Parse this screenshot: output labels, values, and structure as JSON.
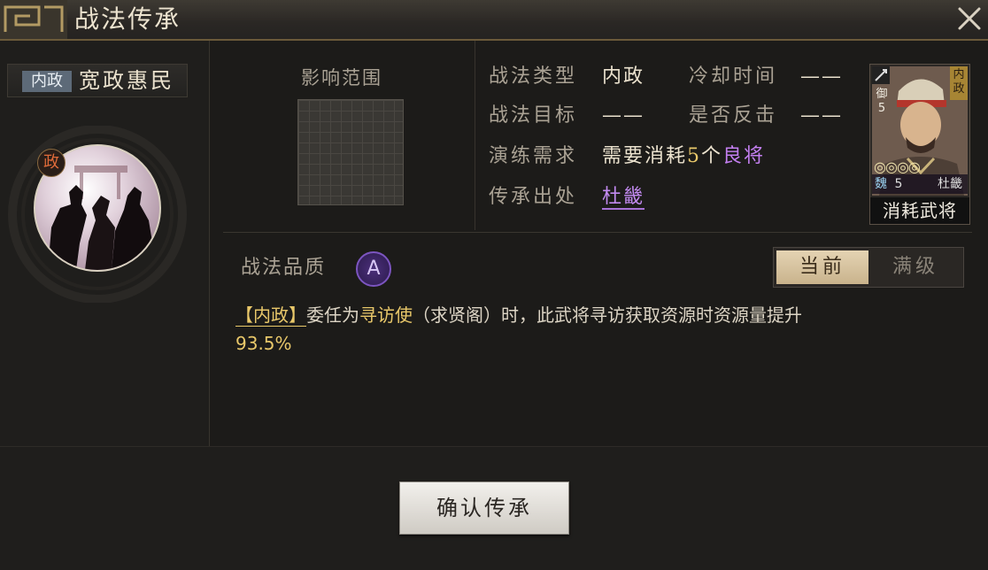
{
  "window": {
    "title": "战法传承",
    "close_icon": "close-icon"
  },
  "skill": {
    "type_badge": "内政",
    "name": "宽政惠民",
    "icon_badge": "政"
  },
  "range": {
    "label": "影响范围"
  },
  "info": {
    "type_label": "战法类型",
    "type_value": "内政",
    "cooldown_label": "冷却时间",
    "cooldown_value": "——",
    "target_label": "战法目标",
    "target_value": "——",
    "counter_label": "是否反击",
    "counter_value": "——",
    "drill_label": "演练需求",
    "drill_prefix": "需要消耗",
    "drill_count": "5",
    "drill_unit": "个",
    "drill_grade": "良将",
    "source_label": "传承出处",
    "source_value": "杜畿"
  },
  "general_card": {
    "type_tag": "内政",
    "role_tag": "御",
    "cost": "5",
    "faction": "魏",
    "level": "5",
    "name": "杜畿",
    "caption": "消耗武将"
  },
  "quality": {
    "label": "战法品质",
    "grade": "A"
  },
  "toggle": {
    "current": "当前",
    "max": "满级"
  },
  "description": {
    "tag": "【内政】",
    "text1": "委任为",
    "keyword": "寻访使",
    "text2": "（求贤阁）时，此武将寻访获取资源时资源量提升",
    "percent": "93.5%"
  },
  "confirm_button": "确认传承",
  "colors": {
    "gold": "#e9c86a",
    "purple": "#c37ff0",
    "bg": "#1c1b19"
  }
}
